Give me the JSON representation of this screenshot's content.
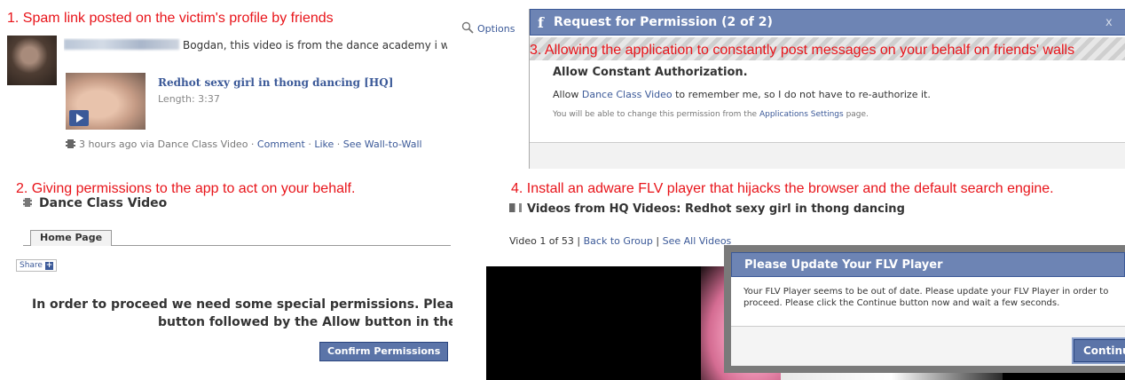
{
  "captions": {
    "step1": "1. Spam link posted on the victim's profile by friends",
    "step2": "2. Giving permissions to the app to act on your behalf.",
    "step3": "3. Allowing the application to constantly post messages on your behalf on friends' walls",
    "step4": "4. Install an adware FLV player that hijacks the browser and the default search engine."
  },
  "post": {
    "message": "Bogdan, this video is from the dance academy i went to last week.. what do u think?",
    "video_title": "Redhot sexy girl in thong dancing [HQ]",
    "video_length": "Length: 3:37",
    "meta_time": "3 hours ago via Dance Class Video",
    "comment": "Comment",
    "like": "Like",
    "wall": "See Wall-to-Wall",
    "separator": "·",
    "options": "Options"
  },
  "permission_dialog": {
    "title": "Request for Permission (2 of 2)",
    "close": "x",
    "heading": "Allow Constant Authorization.",
    "allow_pre": "Allow ",
    "allow_app": "Dance Class Video",
    "allow_post": " to remember me, so I do not have to re-authorize it.",
    "change_pre": "You will be able to change this permission from the ",
    "change_link": "Applications Settings",
    "change_post": " page."
  },
  "app_page": {
    "name": "Dance Class Video",
    "tab": "Home Page",
    "share": "Share",
    "share_plus": "+",
    "instructions_line1": "In order to proceed we need some special permissions. Please do",
    "instructions_line2": "button followed by the Allow button in the d",
    "confirm": "Confirm Permissions"
  },
  "video_page": {
    "heading": "Videos from HQ Videos: Redhot sexy girl in thong dancing",
    "nav_count": "Video 1 of 53",
    "nav_back": "Back to Group",
    "nav_all": "See All Videos",
    "nav_sep": "|"
  },
  "flv_dialog": {
    "title": "Please Update Your FLV Player",
    "body": "Your FLV Player seems to be out of date. Please update your FLV Player in order to proceed. Please click the Continue button now and wait a few seconds.",
    "button": "Continue"
  }
}
